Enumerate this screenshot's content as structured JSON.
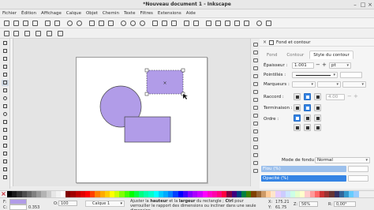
{
  "window": {
    "title": "*Nouveau document 1 - Inkscape"
  },
  "menu": [
    "Fichier",
    "Édition",
    "Affichage",
    "Calque",
    "Objet",
    "Chemin",
    "Texte",
    "Filtres",
    "Extensions",
    "Aide"
  ],
  "panel": {
    "title": "Fond et contour",
    "tabs": [
      "Fond",
      "Contour",
      "Style du contour"
    ],
    "active_tab": "Style du contour",
    "width_label": "Épaisseur :",
    "width_value": "1.001",
    "width_unit": "pt",
    "dashes_label": "Pointillés :",
    "markers_label": "Marqueurs :",
    "join_label": "Raccord :",
    "miter_value": "4.00",
    "cap_label": "Terminaison :",
    "order_label": "Ordre :",
    "blend_label": "Mode de fondu :",
    "blend_value": "Normal",
    "blur_label": "Flou (%)",
    "opacity_label": "Opacité (%)"
  },
  "shapes": {
    "circle_color": "#b19ce8",
    "rect_color": "#b19ce8",
    "selected_color": "#b19ce8"
  },
  "palette": [
    "#000000",
    "#1a1a1a",
    "#333333",
    "#4d4d4d",
    "#666666",
    "#808080",
    "#999999",
    "#b3b3b3",
    "#cccccc",
    "#e6e6e6",
    "#f2f2f2",
    "#ffffff",
    "#800000",
    "#a00000",
    "#c00000",
    "#e00000",
    "#ff0000",
    "#ff4000",
    "#ff8000",
    "#ffaa00",
    "#ffcc00",
    "#ffff00",
    "#ccff00",
    "#80ff00",
    "#40ff00",
    "#00ff00",
    "#00ff40",
    "#00ff80",
    "#00ffaa",
    "#00ffcc",
    "#00ffff",
    "#00ccff",
    "#00aaff",
    "#0080ff",
    "#0040ff",
    "#0000ff",
    "#4000ff",
    "#8000ff",
    "#aa00ff",
    "#cc00ff",
    "#ff00ff",
    "#ff00cc",
    "#ff00aa",
    "#ff0080",
    "#ff0040",
    "#800040",
    "#400080",
    "#004080",
    "#008040",
    "#408000",
    "#804000",
    "#996633",
    "#cc9966",
    "#ffcc99",
    "#ffe6cc",
    "#e6ccff",
    "#ccccff",
    "#cce6ff",
    "#ccffe6",
    "#e6ffcc",
    "#ffffcc",
    "#ffcccc",
    "#ff9999",
    "#ff6666",
    "#cc3333",
    "#993333",
    "#663333",
    "#333366",
    "#336699",
    "#3399cc",
    "#66ccff",
    "#99ccff"
  ],
  "status": {
    "fill_label": "F:",
    "stroke_label": "C:",
    "stroke_value": "0.353",
    "opacity_label": "O:",
    "opacity_value": "100",
    "layer_name": "Calque 1",
    "message_pre": "Ajuster la ",
    "message_b1": "hauteur",
    "message_mid1": " et la ",
    "message_b2": "largeur",
    "message_mid2": " du rectangle ; ",
    "message_b3": "Ctrl",
    "message_post": " pour verrouiller le rapport des dimensions ou incliner dans une seule dimension",
    "x_label": "X:",
    "x_value": "175.21",
    "y_label": "Y:",
    "y_value": "61.75",
    "zoom_label": "Z:",
    "zoom_value": "56%",
    "rotation_label": "R:",
    "rotation_value": "0,00°"
  }
}
